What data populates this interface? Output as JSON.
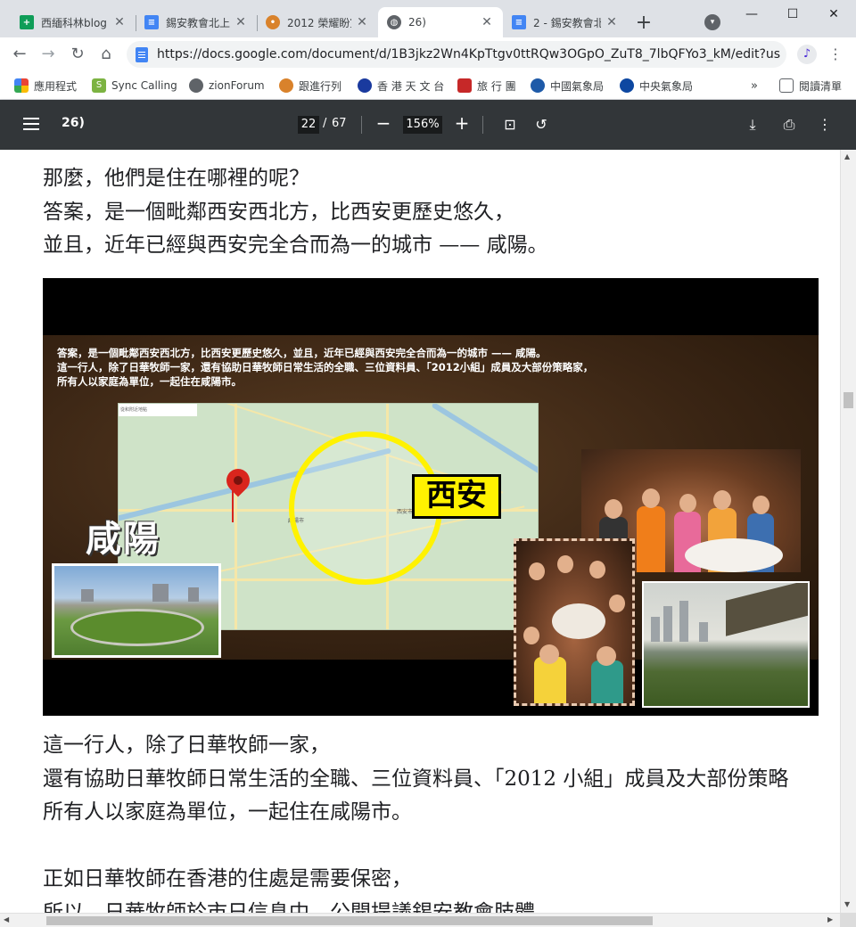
{
  "tabs": [
    {
      "title": "西緬科林blog",
      "icon": "sheets-icon",
      "color": "#0f9d58"
    },
    {
      "title": "錫安教會北上",
      "icon": "docs-icon",
      "color": "#4285f4"
    },
    {
      "title": "2012 榮耀盼室",
      "icon": "site-icon",
      "color": "#d9822b"
    },
    {
      "title": "26)",
      "icon": "globe-icon",
      "color": "#5f6368",
      "active": true
    },
    {
      "title": "2 - 錫安教會北",
      "icon": "docs-icon",
      "color": "#4285f4"
    }
  ],
  "window": {
    "minimize": "—",
    "maximize": "☐",
    "close": "✕"
  },
  "toolbar": {
    "url": "https://docs.google.com/document/d/1B3jkz2Wn4KpTtgv0ttRQw3OGpO_ZuT8_7lbQFYo3_kM/edit?us..."
  },
  "bookmarks": [
    {
      "label": "應用程式",
      "icon": "apps-grid-icon"
    },
    {
      "label": "Sync Calling",
      "icon": "sync-icon"
    },
    {
      "label": "zionForum",
      "icon": "globe-icon"
    },
    {
      "label": "跟進行列",
      "icon": "site-icon"
    },
    {
      "label": "香 港 天 文 台",
      "icon": "hko-icon"
    },
    {
      "label": "旅 行 團",
      "icon": "travel-icon"
    },
    {
      "label": "中國氣象局",
      "icon": "cma-icon"
    },
    {
      "label": "中央氣象局",
      "icon": "cwb-icon"
    },
    {
      "label": "閱讀清單",
      "icon": "reading-list-icon"
    }
  ],
  "pdf": {
    "title": "26)",
    "page": "22",
    "page_sep": "/",
    "total": "67",
    "zoom": "156%"
  },
  "content": {
    "top_lines": [
      "那麼，他們是住在哪裡的呢？",
      "答案，是一個毗鄰西安西北方，比西安更歷史悠久，",
      "並且，近年已經與西安完全合而為一的城市 —— 咸陽。"
    ],
    "bottom_lines": [
      "這一行人，除了日華牧師一家，",
      "還有協助日華牧師日常生活的全職、三位資料員、「2012 小組」成員及大部份策略",
      "所有人以家庭為單位，一起住在咸陽市。",
      "",
      "正如日華牧師在香港的住處是需要保密，",
      "所以，日華牧師於市日信息中，公開提議錫安教會肢體"
    ]
  },
  "slide": {
    "caption_lines": [
      "答案，是一個毗鄰西安西北方，比西安更歷史悠久，並且，近年已經與西安完全合而為一的城市 —— 咸陽。",
      "這一行人，除了日華牧師一家，還有協助日華牧師日常生活的全職、三位資料員、「2012小組」成員及大部份策略家，",
      "所有人以家庭為單位，一起住在咸陽市。"
    ],
    "label_xianyang": "咸陽",
    "label_xian": "西安",
    "map_city_label": "西安市",
    "map_pin_label": "咸陽市",
    "map_search": "從和附近地點"
  }
}
